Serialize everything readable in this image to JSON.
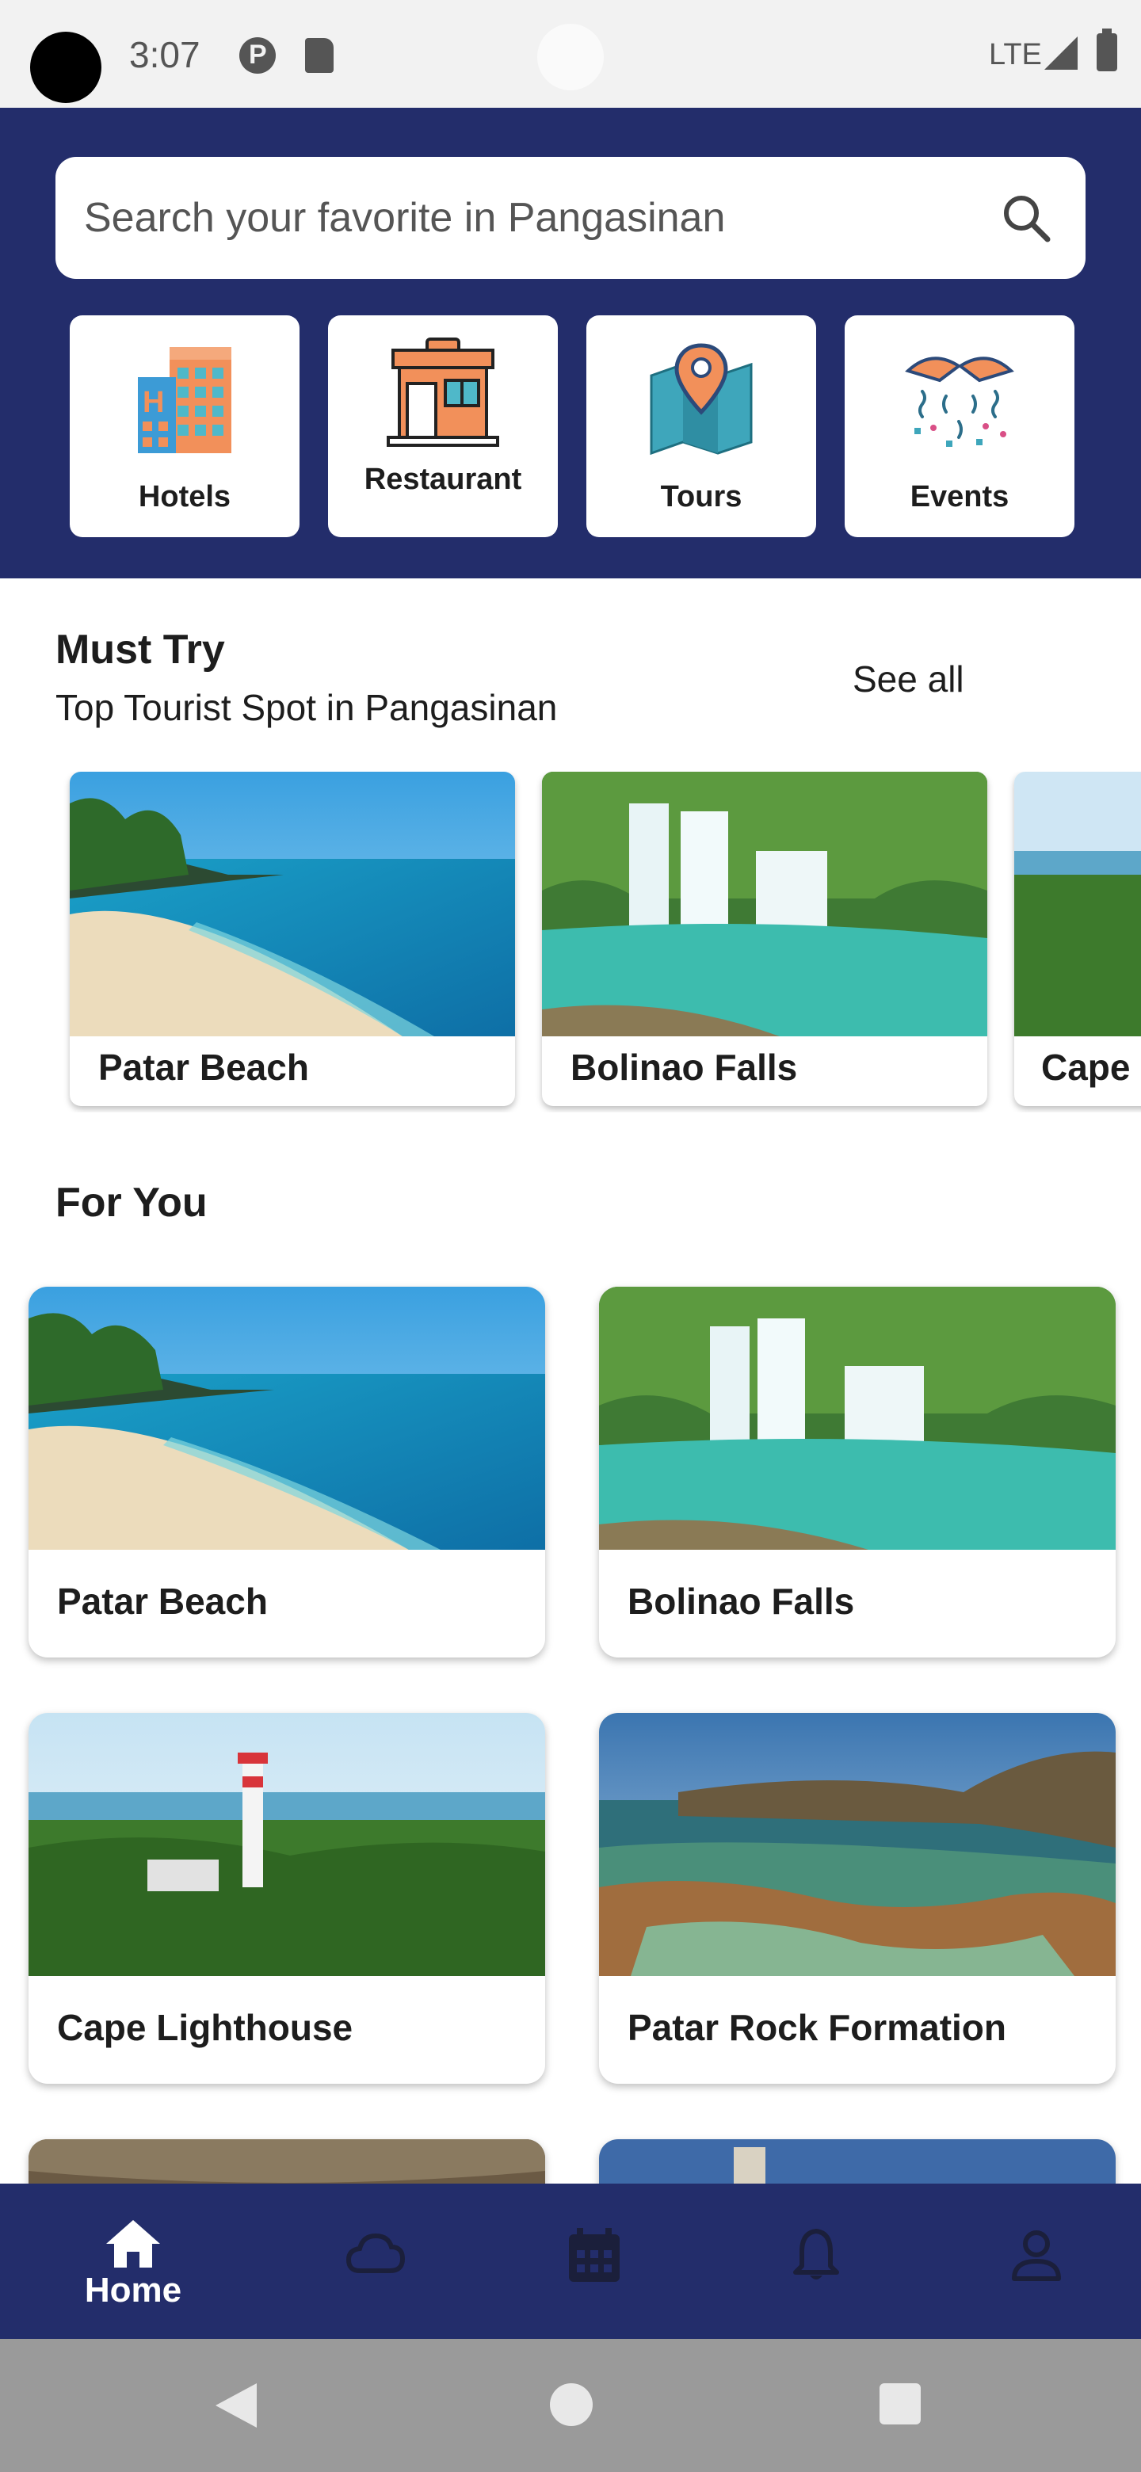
{
  "status_bar": {
    "time": "3:07",
    "network": "LTE"
  },
  "search": {
    "placeholder": "Search your favorite in Pangasinan",
    "icon": "search-icon"
  },
  "categories": [
    {
      "label": "Hotels",
      "icon": "hotel-building-icon"
    },
    {
      "label": "Restaurant",
      "icon": "restaurant-storefront-icon"
    },
    {
      "label": "Tours",
      "icon": "map-pin-icon"
    },
    {
      "label": "Events",
      "icon": "confetti-party-icon"
    }
  ],
  "must_try": {
    "title": "Must Try",
    "subtitle": "Top Tourist Spot in Pangasinan",
    "see_all": "See all",
    "items": [
      {
        "label": "Patar Beach"
      },
      {
        "label": "Bolinao Falls"
      },
      {
        "label": "Cape"
      }
    ]
  },
  "for_you": {
    "title": "For You",
    "items": [
      {
        "label": "Patar Beach"
      },
      {
        "label": "Bolinao Falls"
      },
      {
        "label": "Cape Lighthouse"
      },
      {
        "label": "Patar Rock Formation"
      }
    ]
  },
  "bottom_nav": {
    "items": [
      {
        "label": "Home",
        "icon": "home-icon",
        "active": true
      },
      {
        "label": "",
        "icon": "cloud-icon"
      },
      {
        "label": "",
        "icon": "calendar-icon"
      },
      {
        "label": "",
        "icon": "bell-icon"
      },
      {
        "label": "",
        "icon": "person-icon"
      }
    ]
  },
  "colors": {
    "primary": "#232d6b",
    "background": "#ffffff",
    "text": "#1d1d1d"
  }
}
